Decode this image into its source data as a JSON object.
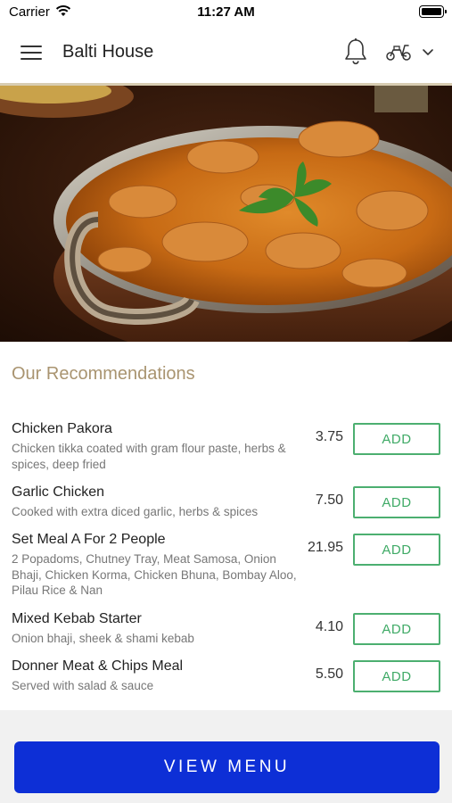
{
  "status_bar": {
    "carrier": "Carrier",
    "time": "11:27 AM"
  },
  "header": {
    "title": "Balti House",
    "icons": [
      "menu-icon",
      "bell-icon",
      "scooter-icon",
      "chevron-down-icon"
    ]
  },
  "hero": {
    "subject": "chicken curry in copper balti dish with coriander garnish"
  },
  "recommendations": {
    "title": "Our Recommendations",
    "add_label": "ADD",
    "items": [
      {
        "name": "Chicken Pakora",
        "description": "Chicken tikka coated with gram flour paste, herbs & spices, deep fried",
        "price": "3.75"
      },
      {
        "name": "Garlic Chicken",
        "description": "Cooked with extra diced garlic, herbs & spices",
        "price": "7.50"
      },
      {
        "name": "Set Meal A For 2 People",
        "description": "2 Popadoms, Chutney Tray, Meat Samosa, Onion Bhaji, Chicken Korma, Chicken Bhuna, Bombay Aloo, Pilau Rice & Nan",
        "price": "21.95"
      },
      {
        "name": "Mixed Kebab Starter",
        "description": "Onion bhaji, sheek & shami kebab",
        "price": "4.10"
      },
      {
        "name": "Donner Meat & Chips Meal",
        "description": "Served with salad & sauce",
        "price": "5.50"
      }
    ]
  },
  "footer": {
    "view_menu_label": "VIEW MENU"
  },
  "colors": {
    "accent_gold": "#a99470",
    "add_green": "#4caf70",
    "primary_blue": "#0d2fd6"
  }
}
